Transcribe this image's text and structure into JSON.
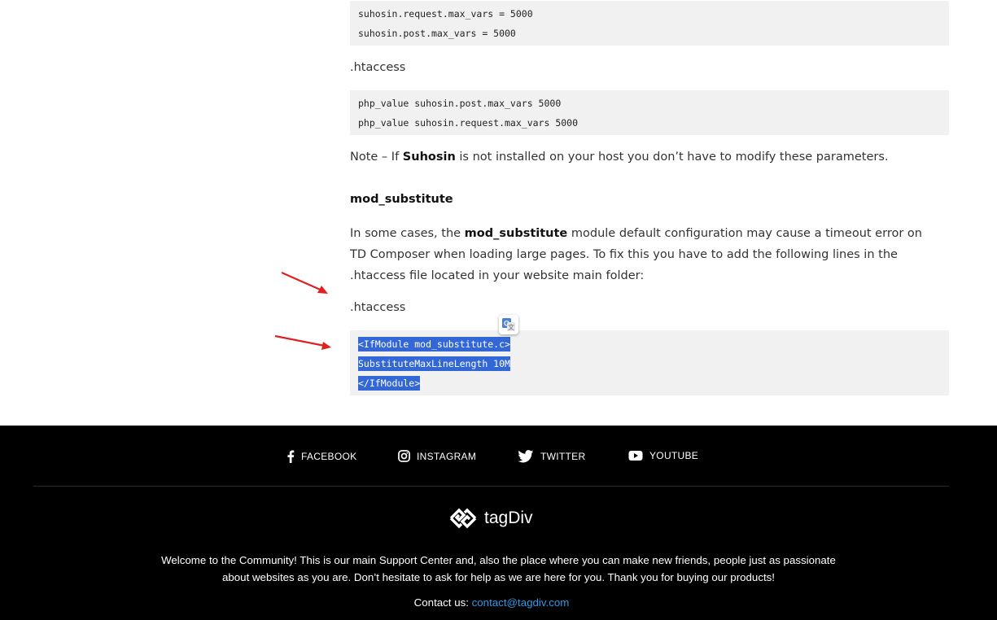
{
  "article": {
    "code1": [
      "suhosin.request.max_vars = 5000",
      "suhosin.post.max_vars = 5000"
    ],
    "htaccess_label_1": ".htaccess",
    "code2": [
      "php_value suhosin.post.max_vars 5000",
      "php_value suhosin.request.max_vars 5000"
    ],
    "note": {
      "prefix": "Note – If ",
      "bold": "Suhosin",
      "suffix": " is not installed on your host you don’t have to modify these parameters."
    },
    "heading": "mod_substitute",
    "paragraph": {
      "prefix": "In some cases, the ",
      "bold": "mod_substitute",
      "suffix": " module default configuration may cause a timeout error on TD Composer when loading large pages. To fix this you have to add the following lines in the .htaccess file located in your website main folder:"
    },
    "htaccess_label_2": ".htaccess",
    "code3": [
      "<IfModule mod_substitute.c>",
      "SubstituteMaxLineLength 10M",
      "</IfModule>"
    ]
  },
  "annotation_color": "#e02020",
  "selection_color": "#3367d6",
  "footer": {
    "social": [
      {
        "label": "FACEBOOK",
        "icon": "facebook-icon"
      },
      {
        "label": "INSTAGRAM",
        "icon": "instagram-icon"
      },
      {
        "label": "TWITTER",
        "icon": "twitter-icon"
      },
      {
        "label": "YOUTUBE",
        "icon": "youtube-icon"
      }
    ],
    "logo_text": "tagDiv",
    "welcome": "Welcome to the Community! This is our main Support Center and, also the place where you can make new friends, people just as passionate about websites as you are. Don’t hesitate to ask for help as we are here for you. Thank you for buying our products!",
    "contact_label": "Contact us:",
    "contact_email": "contact@tagdiv.com",
    "link_color": "#2e9ae8"
  }
}
